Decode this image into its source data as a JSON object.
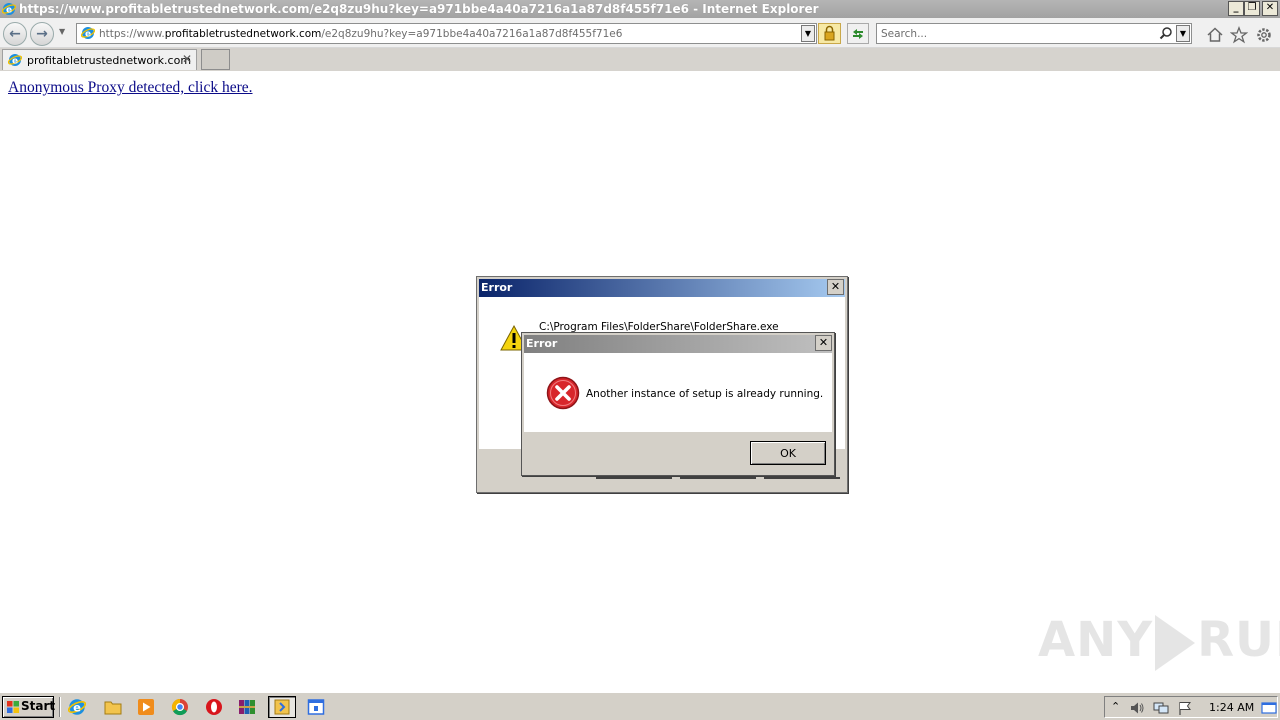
{
  "window": {
    "title": "https://www.profitabletrustednetwork.com/e2q8zu9hu?key=a971bbe4a40a7216a1a87d8f455f71e6 - Internet Explorer"
  },
  "address_bar": {
    "url_prefix": "https://www.",
    "url_domain": "profitabletrustednetwork.com",
    "url_path": "/e2q8zu9hu?key=a971bbe4a40a7216a1a87d8f455f71e6"
  },
  "search": {
    "placeholder": "Search..."
  },
  "tab": {
    "label": "profitabletrustednetwork.com"
  },
  "page": {
    "link_text": "Anonymous Proxy detected, click here."
  },
  "dialog_back": {
    "title": "Error",
    "path": "C:\\Program Files\\FolderShare\\FolderShare.exe"
  },
  "dialog_front": {
    "title": "Error",
    "message": "Another instance of setup is already running.",
    "ok_label": "OK"
  },
  "watermark": {
    "left": "ANY",
    "right": "RUN"
  },
  "taskbar": {
    "start_label": "Start",
    "clock": "1:24 AM"
  },
  "colors": {
    "active_title_start": "#0a246a",
    "active_title_end": "#a6caf0",
    "link": "#0b0b88",
    "error_red": "#d8262b",
    "warning_yellow": "#f5d40f"
  }
}
